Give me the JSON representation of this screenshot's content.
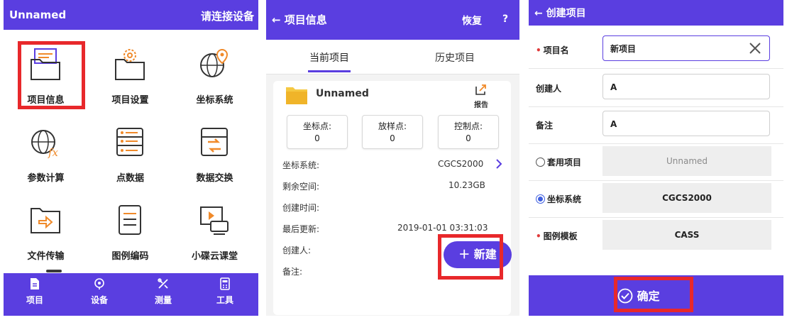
{
  "screen1": {
    "title": "Unnamed",
    "connect": "请连接设备",
    "tiles": [
      {
        "label": "项目信息",
        "icon": "folder-icon"
      },
      {
        "label": "项目设置",
        "icon": "folder-gear-icon"
      },
      {
        "label": "坐标系统",
        "icon": "globe-pin-icon"
      },
      {
        "label": "参数计算",
        "icon": "globe-fx-icon"
      },
      {
        "label": "点数据",
        "icon": "data-list-icon"
      },
      {
        "label": "数据交换",
        "icon": "exchange-icon"
      },
      {
        "label": "文件传输",
        "icon": "folder-transfer-icon"
      },
      {
        "label": "图例编码",
        "icon": "document-icon"
      },
      {
        "label": "小碟云课堂",
        "icon": "video-class-icon"
      }
    ],
    "nav": [
      {
        "label": "项目",
        "icon": "project-icon"
      },
      {
        "label": "设备",
        "icon": "device-icon"
      },
      {
        "label": "测量",
        "icon": "survey-icon"
      },
      {
        "label": "工具",
        "icon": "tools-icon"
      }
    ]
  },
  "screen2": {
    "back_title": "← 项目信息",
    "restore": "恢复",
    "help": "?",
    "tabs": {
      "current": "当前项目",
      "history": "历史项目"
    },
    "project_name": "Unnamed",
    "report": "报告",
    "stats": [
      {
        "label": "坐标点:",
        "value": "0"
      },
      {
        "label": "放样点:",
        "value": "0"
      },
      {
        "label": "控制点:",
        "value": "0"
      }
    ],
    "info": {
      "coord_label": "坐标系统:",
      "coord_value": "CGCS2000",
      "space_label": "剩余空间:",
      "space_value": "10.23GB",
      "created_label": "创建时间:",
      "updated_label": "最后更新:",
      "updated_value": "2019-01-01 03:31:03",
      "creator_label": "创建人:",
      "note_label": "备注:"
    },
    "new_button": "＋ 新建"
  },
  "screen3": {
    "back_title": "← 创建项目",
    "fields": {
      "name_label": "项目名",
      "name_value": "新项目",
      "creator_label": "创建人",
      "creator_value": "A",
      "note_label": "备注",
      "note_value": "A",
      "apply_label": "套用项目",
      "apply_value": "Unnamed",
      "coord_label": "坐标系统",
      "coord_value": "CGCS2000",
      "template_label": "图例模板",
      "template_value": "CASS"
    },
    "confirm": "确定"
  },
  "colors": {
    "accent": "#5a3ee0",
    "highlight": "#e8282b",
    "required": "#e03a3a"
  }
}
